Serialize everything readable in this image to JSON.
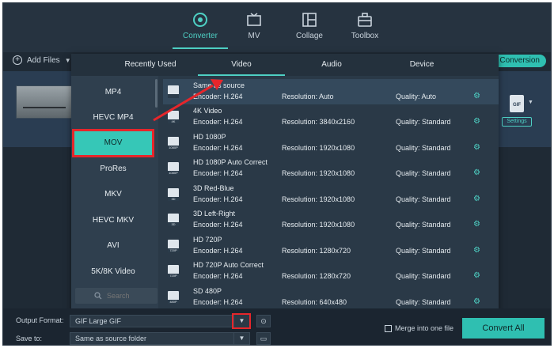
{
  "nav": {
    "items": [
      {
        "label": "Converter",
        "icon": "converter-icon",
        "active": true
      },
      {
        "label": "MV",
        "icon": "mv-icon",
        "active": false
      },
      {
        "label": "Collage",
        "icon": "collage-icon",
        "active": false
      },
      {
        "label": "Toolbox",
        "icon": "toolbox-icon",
        "active": false
      }
    ]
  },
  "toolbar": {
    "add_files": "Add Files",
    "conversion_pill": "ed Conversion"
  },
  "file": {
    "settings_label": "Settings",
    "format_badge": "GIF"
  },
  "popup": {
    "tabs": [
      "Recently Used",
      "Video",
      "Audio",
      "Device"
    ],
    "active_tab": "Video",
    "formats": [
      "MP4",
      "HEVC MP4",
      "MOV",
      "ProRes",
      "MKV",
      "HEVC MKV",
      "AVI",
      "5K/8K Video"
    ],
    "selected_format": "MOV",
    "search_placeholder": "Search",
    "presets": [
      {
        "name": "Same as source",
        "encoder": "Encoder: H.264",
        "resolution": "Resolution: Auto",
        "quality": "Quality: Auto",
        "tag": ""
      },
      {
        "name": "4K Video",
        "encoder": "Encoder: H.264",
        "resolution": "Resolution: 3840x2160",
        "quality": "Quality: Standard",
        "tag": "4K"
      },
      {
        "name": "HD 1080P",
        "encoder": "Encoder: H.264",
        "resolution": "Resolution: 1920x1080",
        "quality": "Quality: Standard",
        "tag": "1080P"
      },
      {
        "name": "HD 1080P Auto Correct",
        "encoder": "Encoder: H.264",
        "resolution": "Resolution: 1920x1080",
        "quality": "Quality: Standard",
        "tag": "1080P"
      },
      {
        "name": "3D Red-Blue",
        "encoder": "Encoder: H.264",
        "resolution": "Resolution: 1920x1080",
        "quality": "Quality: Standard",
        "tag": "3D"
      },
      {
        "name": "3D Left-Right",
        "encoder": "Encoder: H.264",
        "resolution": "Resolution: 1920x1080",
        "quality": "Quality: Standard",
        "tag": "3D"
      },
      {
        "name": "HD 720P",
        "encoder": "Encoder: H.264",
        "resolution": "Resolution: 1280x720",
        "quality": "Quality: Standard",
        "tag": "720P"
      },
      {
        "name": "HD 720P Auto Correct",
        "encoder": "Encoder: H.264",
        "resolution": "Resolution: 1280x720",
        "quality": "Quality: Standard",
        "tag": "720P"
      },
      {
        "name": "SD 480P",
        "encoder": "Encoder: H.264",
        "resolution": "Resolution: 640x480",
        "quality": "Quality: Standard",
        "tag": "480P"
      }
    ]
  },
  "bottom": {
    "output_format_label": "Output Format:",
    "output_format_value": "GIF Large GIF",
    "save_to_label": "Save to:",
    "save_to_value": "Same as source folder",
    "merge_label": "Merge into one file",
    "convert_all": "Convert All"
  },
  "colors": {
    "accent": "#2fbfb1",
    "highlight_red": "#e6262b",
    "background": "#1f2a35"
  }
}
